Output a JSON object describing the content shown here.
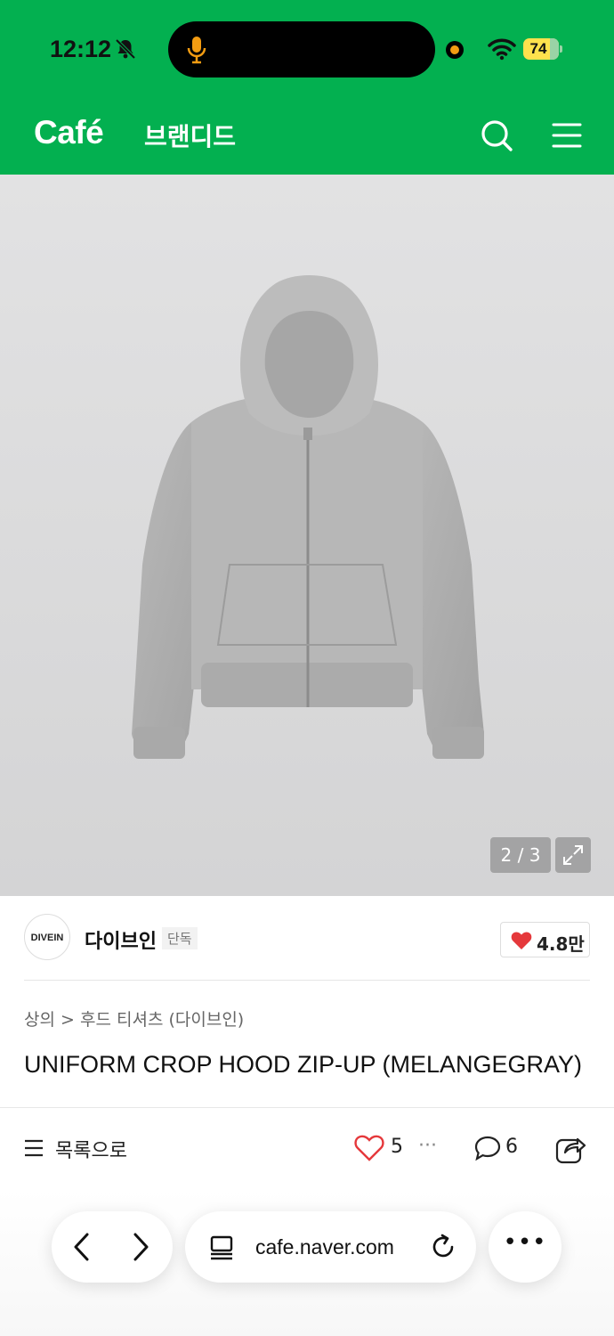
{
  "status_bar": {
    "time": "12:12",
    "battery": "74"
  },
  "header": {
    "logo": "Café",
    "title": "브랜디드"
  },
  "image": {
    "counter": "2 / 3"
  },
  "store": {
    "avatar_text": "DIVEIN",
    "name": "다이브인",
    "badge": "단독",
    "likes": "4.8만"
  },
  "breadcrumb": {
    "category": "상의",
    "separator": ">",
    "subcategory": "후드 티셔츠 (다이브인)"
  },
  "product": {
    "title": "UNIFORM CROP HOOD ZIP-UP (MELANGEGRAY)"
  },
  "actions": {
    "list_label": "목록으로",
    "like_count": "5",
    "more": "···",
    "comment_count": "6"
  },
  "browser": {
    "url": "cafe.naver.com",
    "more": "•••"
  },
  "colors": {
    "brand_green": "#03b050",
    "heart_red": "#e5383b"
  }
}
